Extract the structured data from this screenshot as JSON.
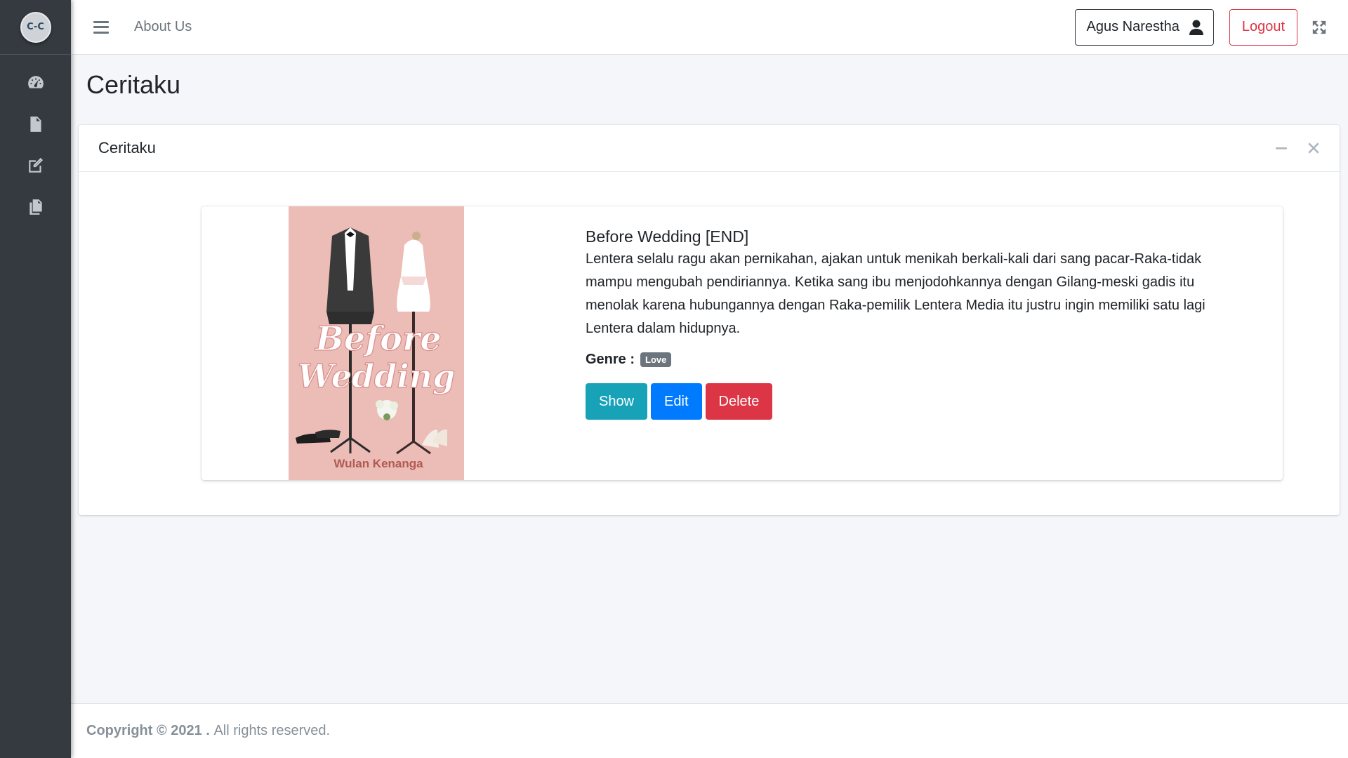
{
  "brand": {
    "logo_text": "C-C"
  },
  "sidebar": {
    "items": [
      {
        "icon": "tachometer-icon",
        "name": "sidebar-item-dashboard"
      },
      {
        "icon": "file-icon",
        "name": "sidebar-item-stories"
      },
      {
        "icon": "edit-icon",
        "name": "sidebar-item-write"
      },
      {
        "icon": "copy-icon",
        "name": "sidebar-item-collection"
      }
    ]
  },
  "navbar": {
    "about_label": "About Us",
    "user_name": "Agus Narestha",
    "logout_label": "Logout"
  },
  "page": {
    "title": "Ceritaku"
  },
  "card": {
    "title": "Ceritaku"
  },
  "story": {
    "cover": {
      "title_line1": "Before",
      "title_line2": "Wedding",
      "author": "Wulan Kenanga"
    },
    "title": "Before Wedding [END]",
    "description": "Lentera selalu ragu akan pernikahan, ajakan untuk menikah berkali-kali dari sang pacar-Raka-tidak mampu mengubah pendiriannya. Ketika sang ibu menjodohkannya dengan Gilang-meski gadis itu menolak karena hubungannya dengan Raka-pemilik Lentera Media itu justru ingin memiliki satu lagi Lentera dalam hidupnya.",
    "genre_label": "Genre :",
    "genre": "Love",
    "actions": {
      "show": "Show",
      "edit": "Edit",
      "delete": "Delete"
    }
  },
  "footer": {
    "copyright": "Copyright © 2021 .",
    "rights": "All rights reserved."
  },
  "colors": {
    "sidebar_bg": "#343a40",
    "content_bg": "#f4f6f9",
    "info": "#17a2b8",
    "primary": "#007bff",
    "danger": "#dc3545",
    "secondary": "#6c757d"
  }
}
